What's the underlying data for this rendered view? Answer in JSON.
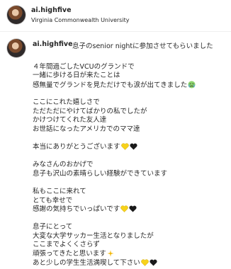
{
  "post": {
    "username": "ai.highfive",
    "location": "Virginia Commonwealth University"
  },
  "caption": {
    "username": "ai.highfive",
    "first_line": "息子のsenior nightに参加させてもらいました",
    "l1": "４年間過ごしたVCUのグランドで",
    "l2": "一緒に歩ける日が来たことは",
    "l3": "感無量でグランドを見ただけでも涙が出てきました",
    "l4": "ここにこれた嬉しさで",
    "l5": "ただただにやけてばかりの私でしたが",
    "l6": "かけつけてくれた友人達",
    "l7": "お世話になったアメリカでのママ達",
    "l8": "本当にありがとうございます",
    "l9": "みなさんのおかげで",
    "l10": "息子も沢山の素晴らしい経験ができています",
    "l11": "私もここに来れて",
    "l12": "とても幸せで",
    "l13": "感謝の気持ちでいっぱいです",
    "l14": "息子にとって",
    "l15": "大変な大学サッカー生活となりましたが",
    "l16": "ここまでよくくさらず",
    "l17": "頑張ってきたと思います",
    "l18": "あと少しの学生生活満喫して下さい"
  },
  "colors": {
    "heart_yellow": "#f7d21b",
    "heart_black": "#1a1a1a",
    "text": "#262626"
  },
  "icons": [
    "crying-face-emoji",
    "yellow-heart-emoji",
    "black-heart-emoji",
    "sparkle-emoji"
  ]
}
